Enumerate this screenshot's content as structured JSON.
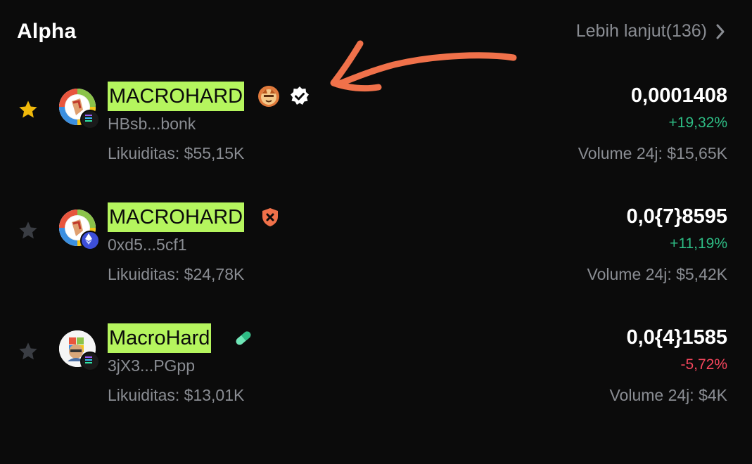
{
  "header": {
    "title": "Alpha",
    "more_label": "Lebih lanjut(136)",
    "more_icon": "chevron-right-icon"
  },
  "annotation": {
    "arrow_color": "#f0714a",
    "highlight_color": "#b5f55e"
  },
  "colors": {
    "background": "#0b0b0b",
    "muted_text": "#8a8d93",
    "positive": "#2ebd85",
    "negative": "#f6465d",
    "star_active": "#f0b90b",
    "star_inactive": "#3a3d43"
  },
  "tokens": [
    {
      "favorite": true,
      "name": "MACROHARD",
      "chain": "solana",
      "badges": [
        "doge-face-icon",
        "verified-check-icon"
      ],
      "address": "HBsb...bonk",
      "liquidity": "Likuiditas: $55,15K",
      "price": "0,0001408",
      "change": "+19,32%",
      "change_direction": "up",
      "volume": "Volume 24j: $15,65K"
    },
    {
      "favorite": false,
      "name": "MACROHARD",
      "chain": "ethereum",
      "badges": [
        "warning-shield-icon"
      ],
      "address": "0xd5...5cf1",
      "liquidity": "Likuiditas: $24,78K",
      "price": "0,0{7}8595",
      "change": "+11,19%",
      "change_direction": "up",
      "volume": "Volume 24j: $5,42K"
    },
    {
      "favorite": false,
      "name": "MacroHard",
      "chain": "solana",
      "badges": [
        "pill-icon"
      ],
      "address": "3jX3...PGpp",
      "liquidity": "Likuiditas: $13,01K",
      "price": "0,0{4}1585",
      "change": "-5,72%",
      "change_direction": "down",
      "volume": "Volume 24j: $4K"
    }
  ]
}
